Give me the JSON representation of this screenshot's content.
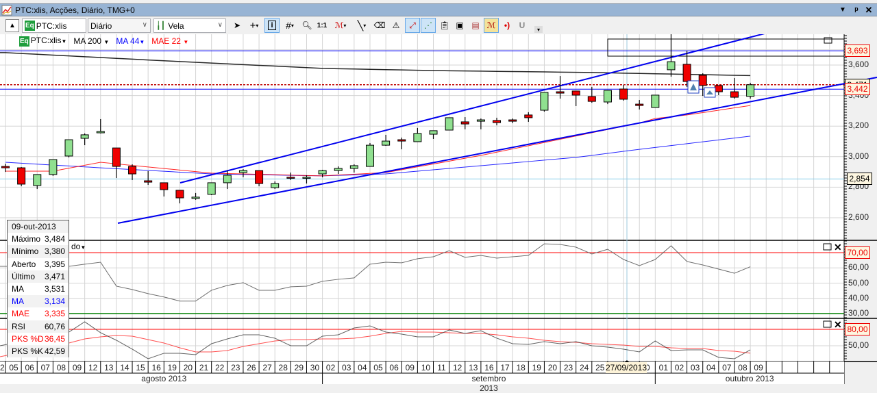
{
  "window": {
    "title": "PTC:xlis, Acções, Diário, TMG+0",
    "buttons": [
      "dropdown-icon",
      "pin-icon",
      "close-icon"
    ]
  },
  "toolbar": {
    "symbol_badge": "Eq",
    "symbol_value": "PTC:xlis",
    "period_value": "Diário",
    "chart_type_value": "Vela",
    "tools": [
      "cursor-arrow-icon",
      "crosshair-icon",
      "info-icon",
      "grid-icon",
      "zoom-icon",
      "one-to-one-icon",
      "indicator-wave-icon",
      "line-tool-icon",
      "eraser-icon",
      "alert-icon",
      "trendline-icon",
      "auto-trend-icon",
      "template-icon",
      "copy-chart-icon",
      "save-chart-icon",
      "wave-highlight-icon",
      "signal-icon",
      "magnet-icon",
      "overflow-icon"
    ],
    "one_to_one_label": "1:1"
  },
  "legend": {
    "symbol_badge": "Eq",
    "symbol": "PTC:xlis",
    "ma200": "MA 200",
    "ma44": "MA 44",
    "mae22": "MAE 22",
    "rsi_panel_label": "do"
  },
  "colors": {
    "up": "#90e090",
    "down": "#f00000",
    "ma200": "#000000",
    "ma44": "#0000ff",
    "mae22": "#ff0000",
    "trendline": "#0000ee",
    "hline": "#0000ff",
    "title_bar": "#98b4d4"
  },
  "info": {
    "date": "09-out-2013",
    "rows": [
      {
        "label": "Máximo",
        "value": "3,484",
        "color": "#000000"
      },
      {
        "label": "Mínimo",
        "value": "3,380",
        "color": "#000000"
      },
      {
        "label": "Aberto",
        "value": "3,395",
        "color": "#000000"
      },
      {
        "label": "Último",
        "value": "3,471",
        "color": "#000000"
      },
      {
        "label": "MA",
        "value": "3,531",
        "color": "#000000"
      },
      {
        "label": "MA",
        "value": "3,134",
        "color": "#0000ff"
      },
      {
        "label": "MAE",
        "value": "3,335",
        "color": "#ff0000"
      },
      {
        "label": "RSI",
        "value": "60,76",
        "color": "#000000"
      },
      {
        "label": "PKS %D",
        "value": "36,45",
        "color": "#ff0000"
      },
      {
        "label": "PKS %K",
        "value": "42,59",
        "color": "#000000"
      }
    ]
  },
  "axes": {
    "price_ticks": [
      "3,600",
      "3,400",
      "3,200",
      "3,000",
      "2,800",
      "2,600"
    ],
    "price_tick_values": [
      3.6,
      3.4,
      3.2,
      3.0,
      2.8,
      2.6
    ],
    "price_labels": {
      "upper_line": "3,693",
      "lower_line": "3,442",
      "last": "3,471",
      "cursor": "2,854"
    },
    "price_label_values": {
      "upper_line": 3.693,
      "lower_line": 3.442,
      "last": 3.471,
      "cursor": 2.854
    },
    "rsi_ticks": [
      "60,00",
      "50,00",
      "40,00",
      "30,00"
    ],
    "rsi_tick_values": [
      60,
      50,
      40,
      30
    ],
    "rsi_upper": "70,00",
    "rsi_levels": [
      70,
      30
    ],
    "stoch_ticks": [
      "50,00"
    ],
    "stoch_tick_values": [
      50
    ],
    "stoch_upper": "80,00",
    "stoch_level": 80,
    "date_prev": "2",
    "dates": [
      "05",
      "06",
      "07",
      "08",
      "09",
      "12",
      "13",
      "14",
      "15",
      "16",
      "19",
      "20",
      "21",
      "22",
      "23",
      "26",
      "27",
      "28",
      "29",
      "30",
      "02",
      "03",
      "04",
      "05",
      "06",
      "09",
      "10",
      "11",
      "12",
      "13",
      "16",
      "17",
      "18",
      "19",
      "20",
      "23",
      "24",
      "25",
      "26",
      "27",
      "0",
      "01",
      "02",
      "03",
      "04",
      "07",
      "08",
      "09"
    ],
    "cursor_date": "27/09/2013",
    "months": [
      "agosto 2013",
      "setembro 2013",
      "outubro 2013"
    ]
  },
  "chart_data": {
    "type": "candlestick",
    "ohlc": [
      [
        2.936,
        2.954,
        2.9,
        2.927
      ],
      [
        2.927,
        2.932,
        2.806,
        2.82
      ],
      [
        2.811,
        2.883,
        2.788,
        2.883
      ],
      [
        2.883,
        2.981,
        2.874,
        2.981
      ],
      [
        3.004,
        3.111,
        2.995,
        3.111
      ],
      [
        3.12,
        3.152,
        3.075,
        3.143
      ],
      [
        3.156,
        3.246,
        3.152,
        3.165
      ],
      [
        3.057,
        3.057,
        2.86,
        2.936
      ],
      [
        2.936,
        2.95,
        2.847,
        2.887
      ],
      [
        2.842,
        2.905,
        2.815,
        2.833
      ],
      [
        2.829,
        2.829,
        2.739,
        2.784
      ],
      [
        2.78,
        2.78,
        2.694,
        2.73
      ],
      [
        2.726,
        2.762,
        2.717,
        2.735
      ],
      [
        2.753,
        2.829,
        2.748,
        2.829
      ],
      [
        2.829,
        2.909,
        2.788,
        2.878
      ],
      [
        2.896,
        2.918,
        2.865,
        2.909
      ],
      [
        2.909,
        2.909,
        2.806,
        2.824
      ],
      [
        2.797,
        2.838,
        2.788,
        2.824
      ],
      [
        2.865,
        2.896,
        2.847,
        2.86
      ],
      [
        2.86,
        2.878,
        2.824,
        2.865
      ],
      [
        2.887,
        2.914,
        2.865,
        2.909
      ],
      [
        2.909,
        2.936,
        2.887,
        2.923
      ],
      [
        2.923,
        2.95,
        2.896,
        2.941
      ],
      [
        2.936,
        3.089,
        2.936,
        3.075
      ],
      [
        3.075,
        3.143,
        3.071,
        3.102
      ],
      [
        3.111,
        3.125,
        3.048,
        3.102
      ],
      [
        3.098,
        3.188,
        3.098,
        3.152
      ],
      [
        3.147,
        3.17,
        3.116,
        3.17
      ],
      [
        3.174,
        3.255,
        3.174,
        3.255
      ],
      [
        3.228,
        3.259,
        3.179,
        3.214
      ],
      [
        3.232,
        3.25,
        3.179,
        3.241
      ],
      [
        3.237,
        3.255,
        3.205,
        3.223
      ],
      [
        3.241,
        3.25,
        3.219,
        3.232
      ],
      [
        3.273,
        3.291,
        3.228,
        3.255
      ],
      [
        3.304,
        3.421,
        3.295,
        3.421
      ],
      [
        3.425,
        3.528,
        3.38,
        3.416
      ],
      [
        3.43,
        3.43,
        3.331,
        3.403
      ],
      [
        3.394,
        3.457,
        3.353,
        3.362
      ],
      [
        3.358,
        3.434,
        3.344,
        3.434
      ],
      [
        3.443,
        3.47,
        3.367,
        3.376
      ],
      [
        3.344,
        3.371,
        3.309,
        3.335
      ],
      [
        3.322,
        3.403,
        3.322,
        3.403
      ],
      [
        3.569,
        3.802,
        3.524,
        3.622
      ],
      [
        3.605,
        3.694,
        3.457,
        3.492
      ],
      [
        3.533,
        3.546,
        3.398,
        3.466
      ],
      [
        3.466,
        3.466,
        3.403,
        3.425
      ],
      [
        3.425,
        3.515,
        3.38,
        3.389
      ],
      [
        3.395,
        3.484,
        3.38,
        3.471
      ]
    ],
    "ma200_points": [
      [
        0,
        3.681
      ],
      [
        10,
        3.628
      ],
      [
        20,
        3.578
      ],
      [
        27,
        3.564
      ],
      [
        37,
        3.551
      ],
      [
        47,
        3.531
      ]
    ],
    "ma44_points": [
      [
        0,
        2.963
      ],
      [
        6,
        2.927
      ],
      [
        13,
        2.887
      ],
      [
        20,
        2.874
      ],
      [
        24,
        2.887
      ],
      [
        30,
        2.941
      ],
      [
        36,
        2.995
      ],
      [
        40,
        3.048
      ],
      [
        47,
        3.134
      ]
    ],
    "mae22_points": [
      [
        0,
        2.905
      ],
      [
        3,
        2.905
      ],
      [
        6,
        2.963
      ],
      [
        13,
        2.892
      ],
      [
        20,
        2.874
      ],
      [
        24,
        2.896
      ],
      [
        30,
        3.008
      ],
      [
        40,
        3.22
      ],
      [
        41,
        3.25
      ],
      [
        43,
        3.273
      ],
      [
        47,
        3.335
      ]
    ],
    "rsi_start_index": 4,
    "rsi": [
      61.0,
      62.4,
      63.7,
      48.0,
      45.8,
      43.1,
      40.9,
      38.2,
      38.2,
      45.3,
      48.5,
      50.3,
      45.3,
      45.3,
      47.6,
      48.0,
      51.2,
      52.5,
      53.4,
      62.4,
      63.7,
      63.3,
      66.0,
      67.3,
      71.3,
      66.9,
      68.2,
      66.4,
      67.3,
      68.2,
      75.8,
      75.4,
      73.6,
      69.1,
      72.2,
      65.5,
      61.5,
      65.5,
      74.5,
      64.2,
      61.9,
      59.2,
      56.5,
      60.76
    ],
    "stoch_start_index": 4,
    "stoch_k": [
      75.0,
      93.8,
      73.8,
      60.0,
      43.8,
      26.3,
      36.3,
      36.3,
      33.8,
      53.8,
      62.5,
      70.0,
      70.0,
      63.8,
      50.0,
      50.0,
      67.5,
      70.0,
      82.5,
      86.3,
      75.0,
      71.3,
      66.3,
      66.3,
      78.8,
      72.5,
      77.5,
      63.8,
      53.8,
      52.5,
      57.5,
      53.8,
      57.5,
      50.0,
      47.5,
      43.8,
      38.8,
      58.8,
      41.3,
      42.5,
      42.5,
      28.8,
      26.3,
      42.59
    ],
    "stoch_d": [
      55.0,
      62.5,
      66.3,
      68.8,
      67.5,
      61.3,
      55.0,
      46.3,
      38.8,
      38.8,
      41.3,
      48.8,
      53.8,
      58.8,
      61.3,
      61.3,
      62.5,
      62.5,
      63.8,
      67.5,
      72.5,
      76.3,
      75.0,
      75.0,
      73.8,
      72.5,
      72.5,
      70.0,
      66.3,
      63.8,
      60.0,
      57.5,
      56.3,
      53.8,
      52.5,
      51.3,
      48.8,
      48.8,
      46.3,
      45.0,
      45.0,
      41.3,
      40.0,
      36.45
    ],
    "hlines": {
      "upper": 3.693,
      "lower": 3.442,
      "last_close": 3.471,
      "cursor": 2.854
    },
    "grid": true
  }
}
